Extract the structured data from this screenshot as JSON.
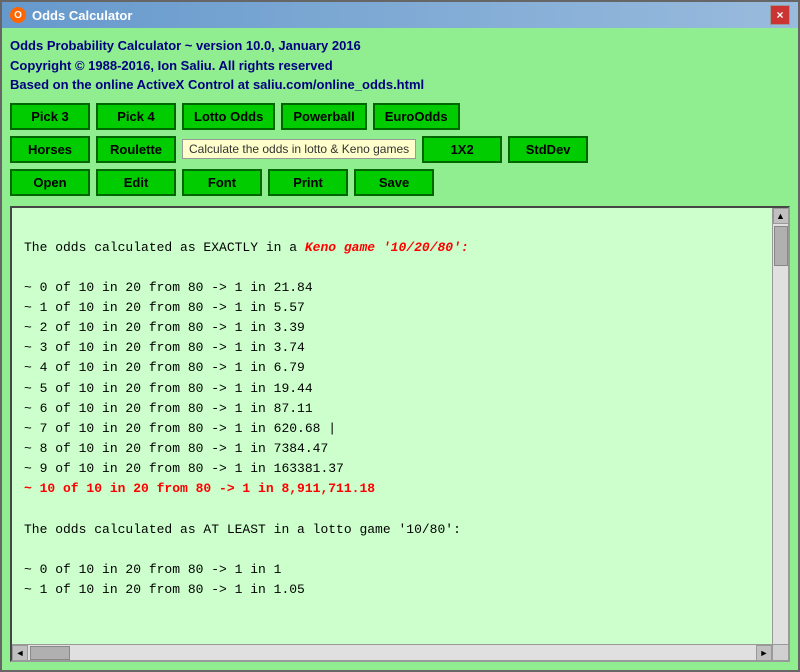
{
  "titleBar": {
    "title": "Odds Calculator",
    "closeLabel": "×"
  },
  "header": {
    "line1": "Odds Probability Calculator ~ version 10.0, January 2016",
    "line2": "Copyright © 1988-2016, Ion Saliu. All rights reserved",
    "line3": "Based on the online ActiveX Control at saliu.com/online_odds.html"
  },
  "buttons": {
    "row1": [
      {
        "id": "pick3",
        "label": "Pick 3"
      },
      {
        "id": "pick4",
        "label": "Pick 4"
      },
      {
        "id": "lotto-odds",
        "label": "Lotto Odds"
      },
      {
        "id": "powerball",
        "label": "Powerball"
      },
      {
        "id": "euro-odds",
        "label": "EuroOdds"
      }
    ],
    "row2": [
      {
        "id": "horses",
        "label": "Horses"
      },
      {
        "id": "roulette",
        "label": "Roulette"
      },
      {
        "id": "1x2",
        "label": "1X2"
      },
      {
        "id": "stddev",
        "label": "StdDev"
      }
    ],
    "row3": [
      {
        "id": "open",
        "label": "Open"
      },
      {
        "id": "edit",
        "label": "Edit"
      },
      {
        "id": "font",
        "label": "Font"
      },
      {
        "id": "print",
        "label": "Print"
      },
      {
        "id": "save",
        "label": "Save"
      }
    ],
    "tooltip": "Calculate the odds in lotto & Keno games"
  },
  "content": {
    "lines": [
      {
        "type": "normal",
        "text": ""
      },
      {
        "type": "normal",
        "text": "The odds calculated as EXACTLY in a  Keno game '10/20/80':"
      },
      {
        "type": "normal",
        "text": ""
      },
      {
        "type": "normal",
        "text": "~ 0 of 10 in 20 from 80   ->  1 in 21.84"
      },
      {
        "type": "normal",
        "text": "~ 1 of 10 in 20 from 80   ->  1 in 5.57"
      },
      {
        "type": "normal",
        "text": "~ 2 of 10 in 20 from 80   ->  1 in 3.39"
      },
      {
        "type": "normal",
        "text": "~ 3 of 10 in 20 from 80   ->  1 in 3.74"
      },
      {
        "type": "normal",
        "text": "~ 4 of 10 in 20 from 80   ->  1 in 6.79"
      },
      {
        "type": "normal",
        "text": "~ 5 of 10 in 20 from 80   ->  1 in 19.44"
      },
      {
        "type": "normal",
        "text": "~ 6 of 10 in 20 from 80   ->  1 in 87.11"
      },
      {
        "type": "normal",
        "text": "~ 7 of 10 in 20 from 80   ->  1 in 620.68 |"
      },
      {
        "type": "normal",
        "text": "~ 8 of 10 in 20 from 80   ->  1 in 7384.47"
      },
      {
        "type": "normal",
        "text": "~ 9 of 10 in 20 from 80   ->  1 in 163381.37"
      },
      {
        "type": "red",
        "text": "~ 10 of 10 in 20 from 80   ->  1 in 8,911,711.18"
      },
      {
        "type": "normal",
        "text": ""
      },
      {
        "type": "normal",
        "text": "The odds calculated as AT LEAST in a lotto game '10/80':"
      },
      {
        "type": "normal",
        "text": ""
      },
      {
        "type": "normal",
        "text": "~ 0 of 10 in 20 from 80   ->  1 in 1"
      },
      {
        "type": "normal",
        "text": "~ 1 of 10 in 20 from 80   ->  1 in 1.05"
      }
    ]
  },
  "keno_label": "Keno game '10/20/80':"
}
